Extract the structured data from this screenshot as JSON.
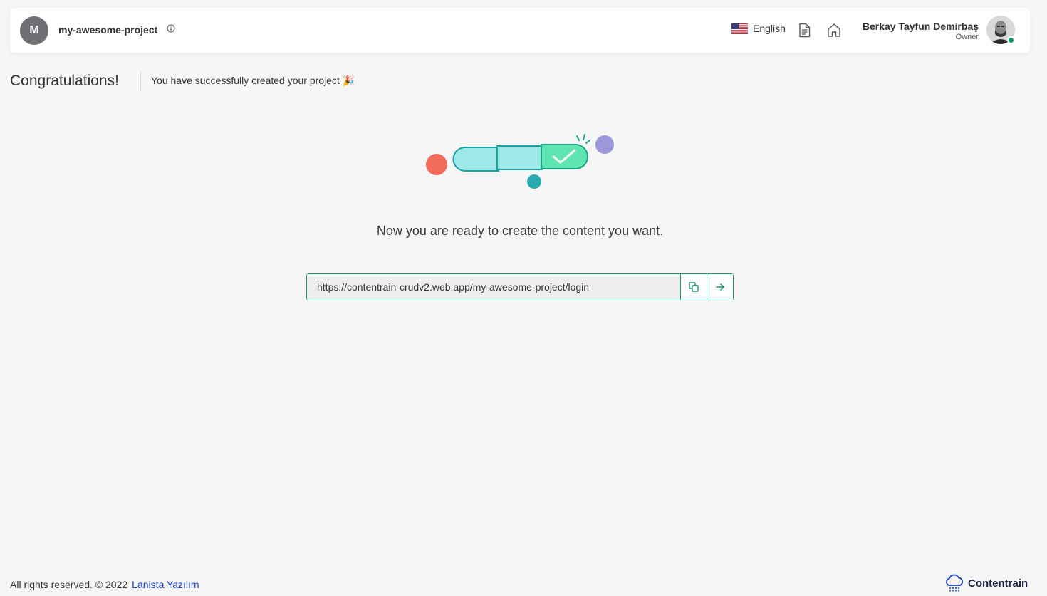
{
  "header": {
    "project_initial": "M",
    "project_name": "my-awesome-project",
    "language_label": "English",
    "user_name": "Berkay Tayfun Demirbaş",
    "user_role": "Owner"
  },
  "main": {
    "title": "Congratulations!",
    "subtitle": "You have successfully created your project 🎉",
    "ready_message": "Now you are ready to create the content you want.",
    "project_url": "https://contentrain-crudv2.web.app/my-awesome-project/login"
  },
  "footer": {
    "rights_text": "All rights reserved. © 2022",
    "company_link": "Lanista Yazılım",
    "brand_name": "Contentrain"
  },
  "icons": {
    "info": "info-icon",
    "flag": "us-flag-icon",
    "docs": "document-icon",
    "home": "home-icon",
    "copy": "copy-icon",
    "go": "arrow-right-icon",
    "brand": "contentrain-cloud-logo"
  },
  "colors": {
    "accent": "#1f8f72",
    "link": "#1a3fd1",
    "online": "#0d9a74",
    "avatar_bg": "#6e6e73"
  }
}
